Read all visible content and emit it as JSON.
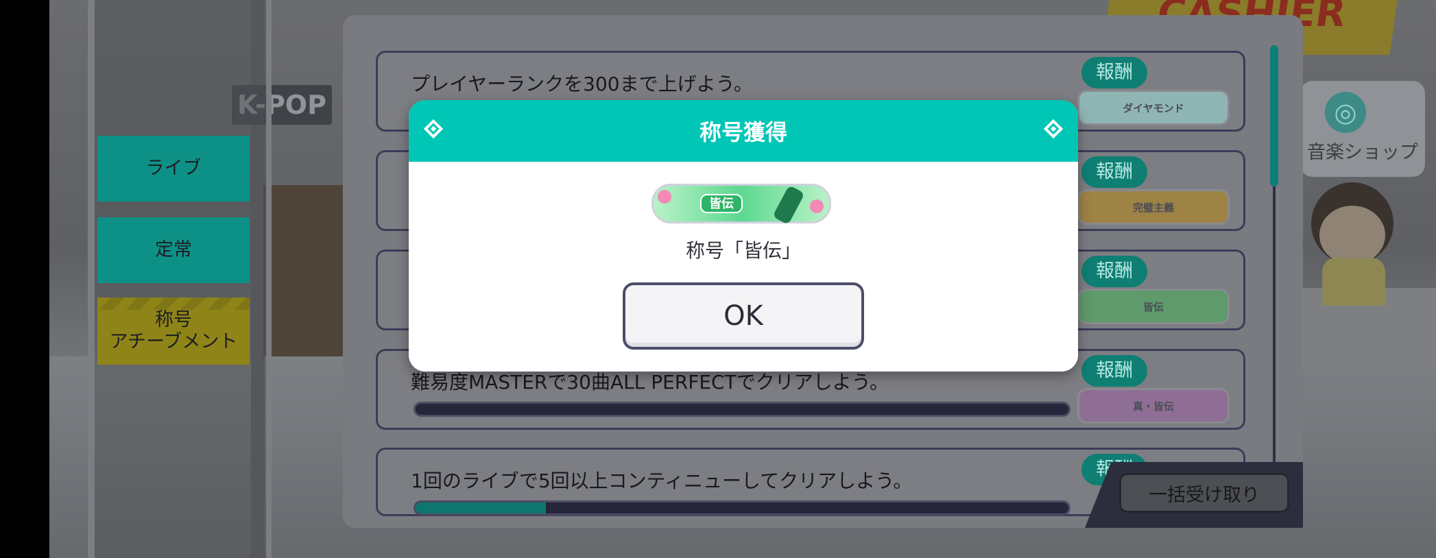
{
  "background": {
    "kpop_sign": "K-POP",
    "cashier_sign": "CASHIER",
    "music_shop_label": "音楽ショップ",
    "music_shop_icon": "music-disc-icon"
  },
  "sidebar": {
    "items": [
      {
        "label": "ライブ"
      },
      {
        "label": "定常"
      },
      {
        "label_line1": "称号",
        "label_line2": "アチーブメント"
      }
    ]
  },
  "missions": [
    {
      "text": "プレイヤーランクを300まで上げよう。",
      "reward_label": "報酬",
      "reward_item": "ダイヤモンド",
      "reward_color": "#8fb6b4"
    },
    {
      "text": "",
      "reward_label": "報酬",
      "reward_item": "完璧主義",
      "reward_color": "#9e8346"
    },
    {
      "text": "",
      "reward_label": "報酬",
      "reward_item": "皆伝",
      "reward_color": "#5e9a6b"
    },
    {
      "text": "難易度MASTERで30曲ALL PERFECTでクリアしよう。",
      "reward_label": "報酬",
      "reward_item": "真・皆伝",
      "reward_color": "#8f6e96",
      "progress": 0
    },
    {
      "text": "1回のライブで5回以上コンティニューしてクリアしよう。",
      "reward_label": "報酬",
      "reward_item": "",
      "reward_color": "#8b6e6e",
      "progress": 0.2
    }
  ],
  "bulk_receive_button": "一括受け取り",
  "dialog": {
    "title": "称号獲得",
    "badge_text": "皆伝",
    "title_name": "称号「皆伝」",
    "ok_label": "OK"
  },
  "colors": {
    "accent": "#00c6b6",
    "dim_tab": "#0d9186",
    "selected_tab": "#8f8418"
  }
}
